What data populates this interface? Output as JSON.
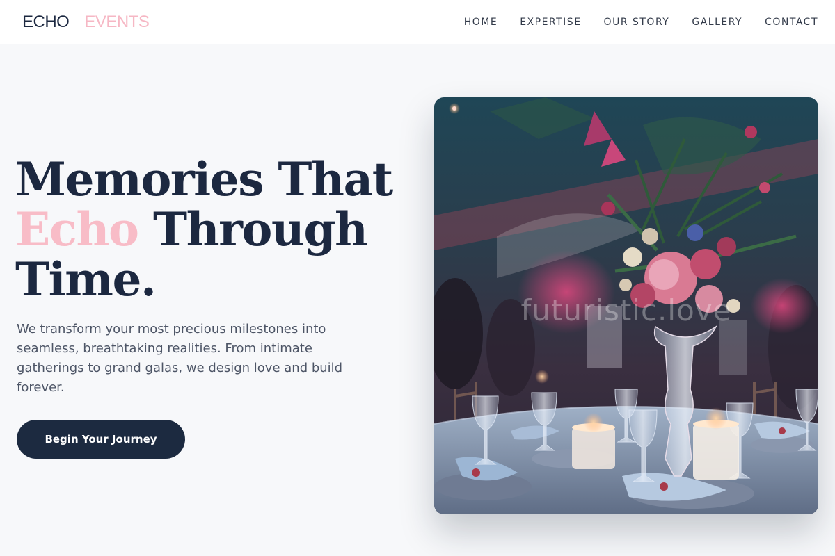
{
  "brand": {
    "name_primary": "ECHO",
    "name_secondary": "EVENTS"
  },
  "nav": {
    "items": [
      {
        "label": "HOME"
      },
      {
        "label": "EXPERTISE"
      },
      {
        "label": "OUR STORY"
      },
      {
        "label": "GALLERY"
      },
      {
        "label": "CONTACT"
      }
    ]
  },
  "hero": {
    "headline_line1": "Memories That",
    "headline_accent": "Echo",
    "headline_line2_rest": " Through",
    "headline_line3": "Time.",
    "subtitle": "We transform your most precious milestones into seamless, breathtaking realities. From intimate gatherings to grand galas, we design love and build forever.",
    "cta_label": "Begin Your Journey",
    "image_watermark": "futuristic.love"
  },
  "colors": {
    "navy": "#1c2840",
    "accent_pink": "#f8bcc7",
    "background": "#f7f8fa"
  }
}
